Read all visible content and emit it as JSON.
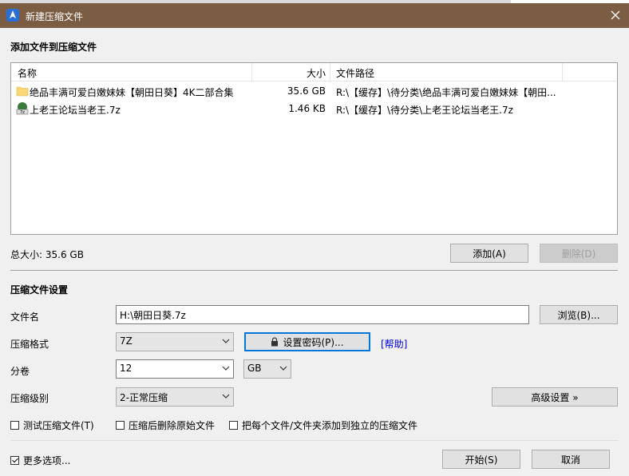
{
  "window": {
    "title": "新建压缩文件",
    "close_glyph": "✕"
  },
  "files_section": {
    "title": "添加文件到压缩文件",
    "columns": {
      "name": "名称",
      "size": "大小",
      "path": "文件路径"
    },
    "rows": [
      {
        "name": "绝品丰满可爱白嫩妹妹【朝田日葵】4K二部合集",
        "size": "35.6 GB",
        "path": "R:\\【缓存】\\待分类\\绝品丰满可爱白嫩妹妹【朝田...",
        "icon": "folder-icon"
      },
      {
        "name": "上老王论坛当老王.7z",
        "size": "1.46 KB",
        "path": "R:\\【缓存】\\待分类\\上老王论坛当老王.7z",
        "icon": "7z-archive-icon"
      }
    ],
    "total_size": "总大小: 35.6 GB",
    "add_label": "添加(A)",
    "delete_label": "删除(D)"
  },
  "settings": {
    "title": "压缩文件设置",
    "filename_label": "文件名",
    "filename_value": "H:\\朝田日葵.7z",
    "browse_label": "浏览(B)...",
    "format_label": "压缩格式",
    "format_value": "7Z",
    "password_label": "设置密码(P)...",
    "help_label": "[帮助]",
    "volume_label": "分卷",
    "volume_value": "12",
    "volume_unit": "GB",
    "level_label": "压缩级别",
    "level_value": "2-正常压缩",
    "advanced_label": "高级设置 »",
    "test_label": "测试压缩文件(T)",
    "delete_after_label": "压缩后删除原始文件",
    "separate_label": "把每个文件/文件夹添加到独立的压缩文件"
  },
  "footer": {
    "more_options_label": "更多选项...",
    "start_label": "开始(S)",
    "cancel_label": "取消"
  },
  "colors": {
    "titlebar": "#7b5d43",
    "accent": "#0078d7",
    "link": "#0000ee"
  }
}
